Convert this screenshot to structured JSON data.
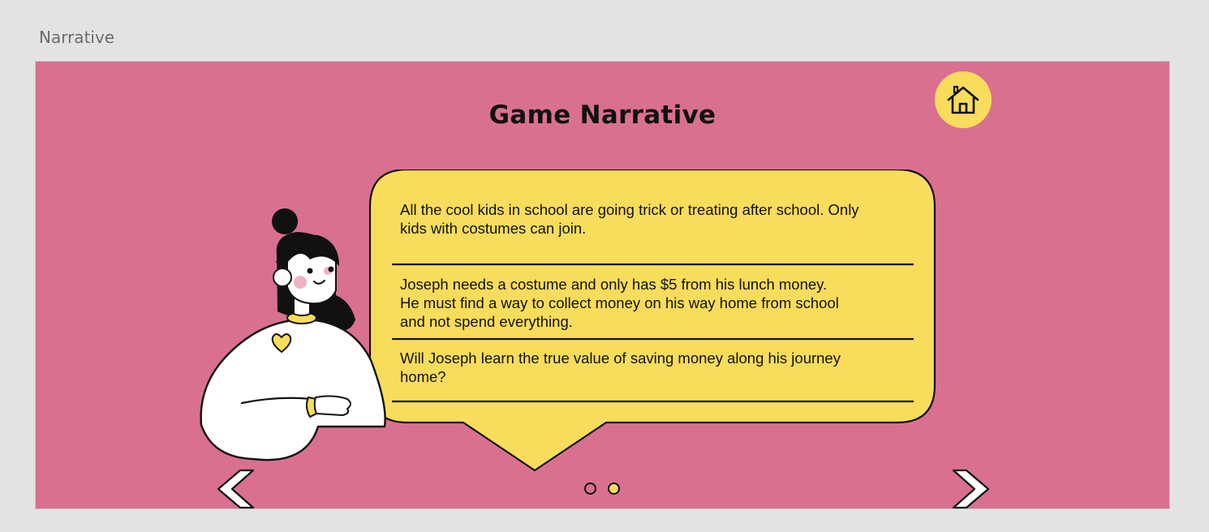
{
  "artboard": {
    "label": "Narrative"
  },
  "page": {
    "title": "Game Narrative"
  },
  "colors": {
    "background": "#d97090",
    "bubble": "#f8dc5c",
    "outline": "#111111"
  },
  "icons": {
    "home": "home-icon",
    "previous": "chevron-left-icon",
    "next": "chevron-right-icon"
  },
  "narrative": {
    "paragraph_1_line_1": "All the cool kids in school are going trick or treating after school. Only",
    "paragraph_1_line_2": "kids with costumes can join.",
    "paragraph_2_line_1": "Joseph needs a costume and only has $5 from his lunch money.",
    "paragraph_2_line_2": "He must find a way to collect money on his way home from school",
    "paragraph_2_line_3": "and not spend everything.",
    "paragraph_3_line_1": "Will Joseph learn the true value of saving money along his journey",
    "paragraph_3_line_2": "home?"
  },
  "pagination": {
    "total": 2,
    "current": 2
  }
}
